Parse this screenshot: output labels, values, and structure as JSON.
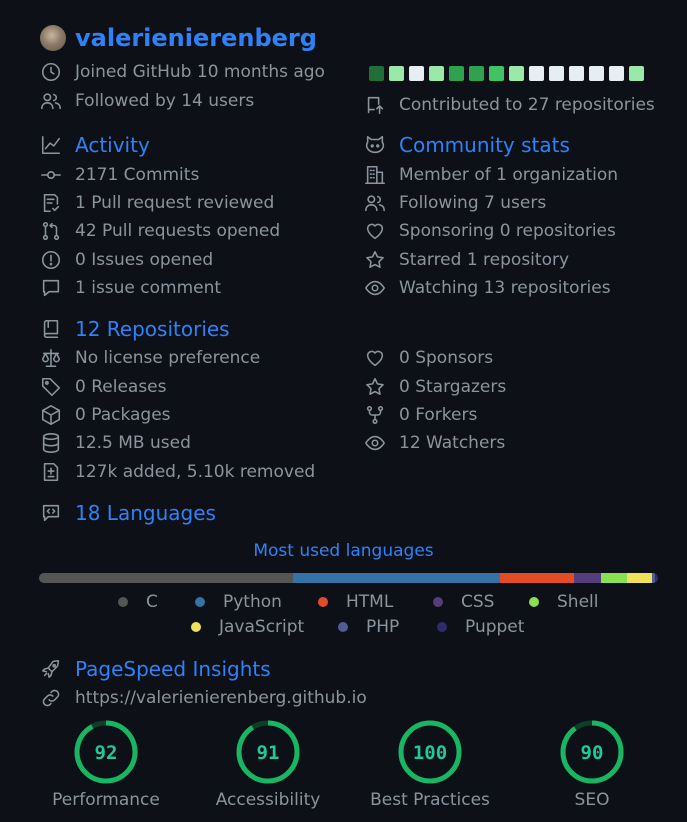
{
  "user": {
    "name": "valerienierenberg"
  },
  "profile": {
    "joined": "Joined GitHub 10 months ago",
    "followed": "Followed by 14 users",
    "contributed": "Contributed to 27 repositories"
  },
  "calendar": {
    "levels": [
      4,
      1,
      0,
      1,
      3,
      3,
      2,
      1,
      0,
      0,
      0,
      0,
      0,
      1
    ]
  },
  "activity": {
    "title": "Activity",
    "items": [
      {
        "icon": "commit-icon",
        "text": "2171 Commits"
      },
      {
        "icon": "pr-reviewed-icon",
        "text": "1 Pull request reviewed"
      },
      {
        "icon": "pull-request-icon",
        "text": "42 Pull requests opened"
      },
      {
        "icon": "issue-icon",
        "text": "0 Issues opened"
      },
      {
        "icon": "comment-icon",
        "text": "1 issue comment"
      }
    ]
  },
  "community": {
    "title": "Community stats",
    "items": [
      {
        "icon": "organization-icon",
        "text": "Member of 1 organization"
      },
      {
        "icon": "people-icon",
        "text": "Following 7 users"
      },
      {
        "icon": "heart-icon",
        "text": "Sponsoring 0 repositories"
      },
      {
        "icon": "star-icon",
        "text": "Starred 1 repository"
      },
      {
        "icon": "eye-icon",
        "text": "Watching 13 repositories"
      }
    ]
  },
  "repositories": {
    "title": "12 Repositories",
    "left": [
      {
        "icon": "law-icon",
        "text": "No license preference"
      },
      {
        "icon": "tag-icon",
        "text": "0 Releases"
      },
      {
        "icon": "package-icon",
        "text": "0 Packages"
      },
      {
        "icon": "database-icon",
        "text": "12.5 MB used"
      },
      {
        "icon": "diff-icon",
        "text": "127k added, 5.10k removed"
      }
    ],
    "right": [
      {
        "icon": "heart-icon",
        "text": "0 Sponsors"
      },
      {
        "icon": "star-icon",
        "text": "0 Stargazers"
      },
      {
        "icon": "fork-icon",
        "text": "0 Forkers"
      },
      {
        "icon": "eye-icon",
        "text": "12 Watchers"
      }
    ]
  },
  "languages": {
    "title": "18 Languages",
    "chart_title": "Most used languages",
    "bar": [
      {
        "name": "C",
        "color": "#555555",
        "share": 41
      },
      {
        "name": "Python",
        "color": "#3572A5",
        "share": 33.5
      },
      {
        "name": "HTML",
        "color": "#e34c26",
        "share": 12
      },
      {
        "name": "CSS",
        "color": "#563d7c",
        "share": 4.3
      },
      {
        "name": "Shell",
        "color": "#89e051",
        "share": 4.2
      },
      {
        "name": "JavaScript",
        "color": "#f1e05a",
        "share": 4
      },
      {
        "name": "PHP",
        "color": "#4F5D95",
        "share": 0.6
      },
      {
        "name": "Puppet",
        "color": "#302B6D",
        "share": 0.4
      }
    ],
    "legend": [
      {
        "name": "C",
        "color": "#555555"
      },
      {
        "name": "Python",
        "color": "#3572A5"
      },
      {
        "name": "HTML",
        "color": "#e34c26"
      },
      {
        "name": "CSS",
        "color": "#563d7c"
      },
      {
        "name": "Shell",
        "color": "#89e051"
      },
      {
        "name": "JavaScript",
        "color": "#f1e05a"
      },
      {
        "name": "PHP",
        "color": "#4F5D95"
      },
      {
        "name": "Puppet",
        "color": "#302B6D"
      }
    ]
  },
  "pagespeed": {
    "title": "PageSpeed Insights",
    "url": "https://valerienierenberg.github.io",
    "scores": [
      {
        "label": "Performance",
        "value": 92
      },
      {
        "label": "Accessibility",
        "value": 91
      },
      {
        "label": "Best Practices",
        "value": 100
      },
      {
        "label": "SEO",
        "value": 90
      }
    ],
    "color": "#18b663"
  }
}
